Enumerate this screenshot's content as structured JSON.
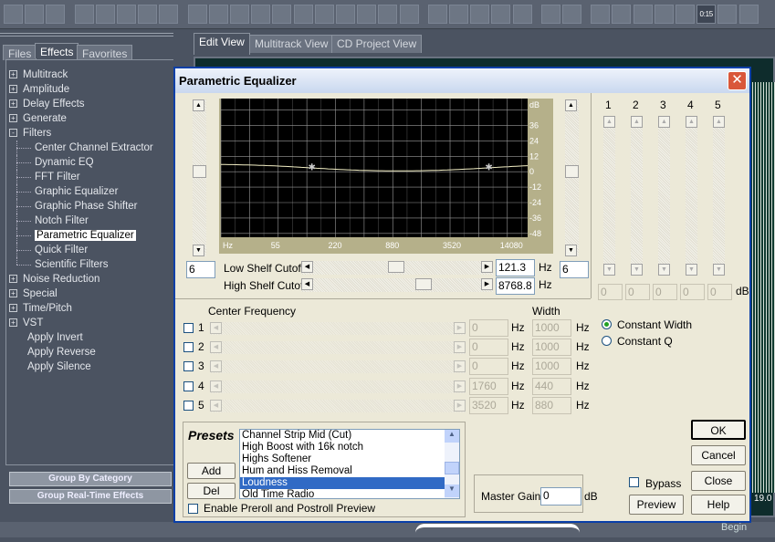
{
  "toolbar": {
    "icons": [
      "waveform-view-icon",
      "multitrack-icon",
      "cd-icon",
      "new-icon",
      "open-icon",
      "save-icon",
      "save-as-icon",
      "save-selection-icon",
      "undo-icon",
      "redo-icon",
      "repeat-icon",
      "crop-icon",
      "copy-icon",
      "cut-icon",
      "paste-icon",
      "mix-paste-icon",
      "trim-icon",
      "zoom-sel-icon",
      "envelope-icon",
      "snap-icon",
      "check-icon",
      "spectral-icon",
      "spectral2-icon",
      "view-icon",
      "cursor-icon",
      "select-icon",
      "window1-icon",
      "window2-icon",
      "window3-icon",
      "play-icon",
      "zoom-icon",
      "time-icon",
      "grid-icon",
      "meter-icon"
    ],
    "time_label": "0:15"
  },
  "left_tabs": [
    "Files",
    "Effects",
    "Favorites"
  ],
  "view_tabs": [
    "Edit View",
    "Multitrack View",
    "CD Project View"
  ],
  "tree": [
    {
      "label": "Multitrack",
      "type": "group",
      "state": "+"
    },
    {
      "label": "Amplitude",
      "type": "group",
      "state": "+"
    },
    {
      "label": "Delay Effects",
      "type": "group",
      "state": "+"
    },
    {
      "label": "Generate",
      "type": "group",
      "state": "+"
    },
    {
      "label": "Filters",
      "type": "group",
      "state": "-"
    },
    {
      "label": "Center Channel Extractor",
      "type": "child"
    },
    {
      "label": "Dynamic EQ",
      "type": "child"
    },
    {
      "label": "FFT Filter",
      "type": "child"
    },
    {
      "label": "Graphic Equalizer",
      "type": "child"
    },
    {
      "label": "Graphic Phase Shifter",
      "type": "child"
    },
    {
      "label": "Notch Filter",
      "type": "child"
    },
    {
      "label": "Parametric Equalizer",
      "type": "child",
      "selected": true
    },
    {
      "label": "Quick Filter",
      "type": "child"
    },
    {
      "label": "Scientific Filters",
      "type": "child"
    },
    {
      "label": "Noise Reduction",
      "type": "group",
      "state": "+"
    },
    {
      "label": "Special",
      "type": "group",
      "state": "+"
    },
    {
      "label": "Time/Pitch",
      "type": "group",
      "state": "+"
    },
    {
      "label": "VST",
      "type": "group",
      "state": "+"
    },
    {
      "label": "Apply Invert",
      "type": "leaf"
    },
    {
      "label": "Apply Reverse",
      "type": "leaf"
    },
    {
      "label": "Apply Silence",
      "type": "leaf"
    }
  ],
  "left_buttons": {
    "group_by_category": "Group By Category",
    "group_realtime": "Group Real-Time Effects"
  },
  "dialog": {
    "title": "Parametric Equalizer",
    "low_gain": "6",
    "high_gain": "6",
    "low_shelf_label": "Low Shelf Cutoff",
    "low_shelf_value": "121.3",
    "high_shelf_label": "High Shelf Cutoff",
    "high_shelf_value": "8768.8",
    "hz": "Hz",
    "db": "dB",
    "band_numbers": [
      "1",
      "2",
      "3",
      "4",
      "5"
    ],
    "band_gains": [
      "0",
      "0",
      "0",
      "0",
      "0"
    ],
    "center_freq_label": "Center Frequency",
    "width_label": "Width",
    "bands": [
      {
        "num": "1",
        "freq": "0",
        "width": "1000"
      },
      {
        "num": "2",
        "freq": "0",
        "width": "1000"
      },
      {
        "num": "3",
        "freq": "0",
        "width": "1000"
      },
      {
        "num": "4",
        "freq": "1760",
        "width": "440"
      },
      {
        "num": "5",
        "freq": "3520",
        "width": "880"
      }
    ],
    "constant_width": "Constant Width",
    "constant_q": "Constant Q",
    "presets_label": "Presets",
    "add": "Add",
    "del": "Del",
    "presets": [
      "Channel Strip Mid (Cut)",
      "High Boost with 16k notch",
      "Highs Softener",
      "Hum and Hiss Removal",
      "Loudness",
      "Old Time Radio"
    ],
    "selected_preset": "Loudness",
    "preroll": "Enable Preroll and Postroll Preview",
    "master_gain_label": "Master Gain",
    "master_gain": "0",
    "bypass": "Bypass",
    "preview": "Preview",
    "ok": "OK",
    "cancel": "Cancel",
    "close": "Close",
    "help": "Help"
  },
  "status": {
    "begin": "Begin",
    "side_value": "19.0"
  },
  "chart_data": {
    "type": "line",
    "xscale": "log",
    "xlim": [
      13.75,
      23000
    ],
    "ylim": [
      -51,
      57
    ],
    "x_ticks": [
      "Hz",
      "55",
      "220",
      "880",
      "3520",
      "14080"
    ],
    "y_ticks": [
      "dB",
      "36",
      "24",
      "12",
      "0",
      "-12",
      "-24",
      "-36",
      "-48"
    ],
    "grid": true,
    "low_shelf": {
      "freq": 121.3,
      "gain_db": 6
    },
    "high_shelf": {
      "freq": 8768.8,
      "gain_db": 6
    },
    "colors": {
      "background": "#000000",
      "grid": "#9a9a9a",
      "curve": "#f2eec4",
      "axis_strip": "#b5b08a"
    }
  }
}
